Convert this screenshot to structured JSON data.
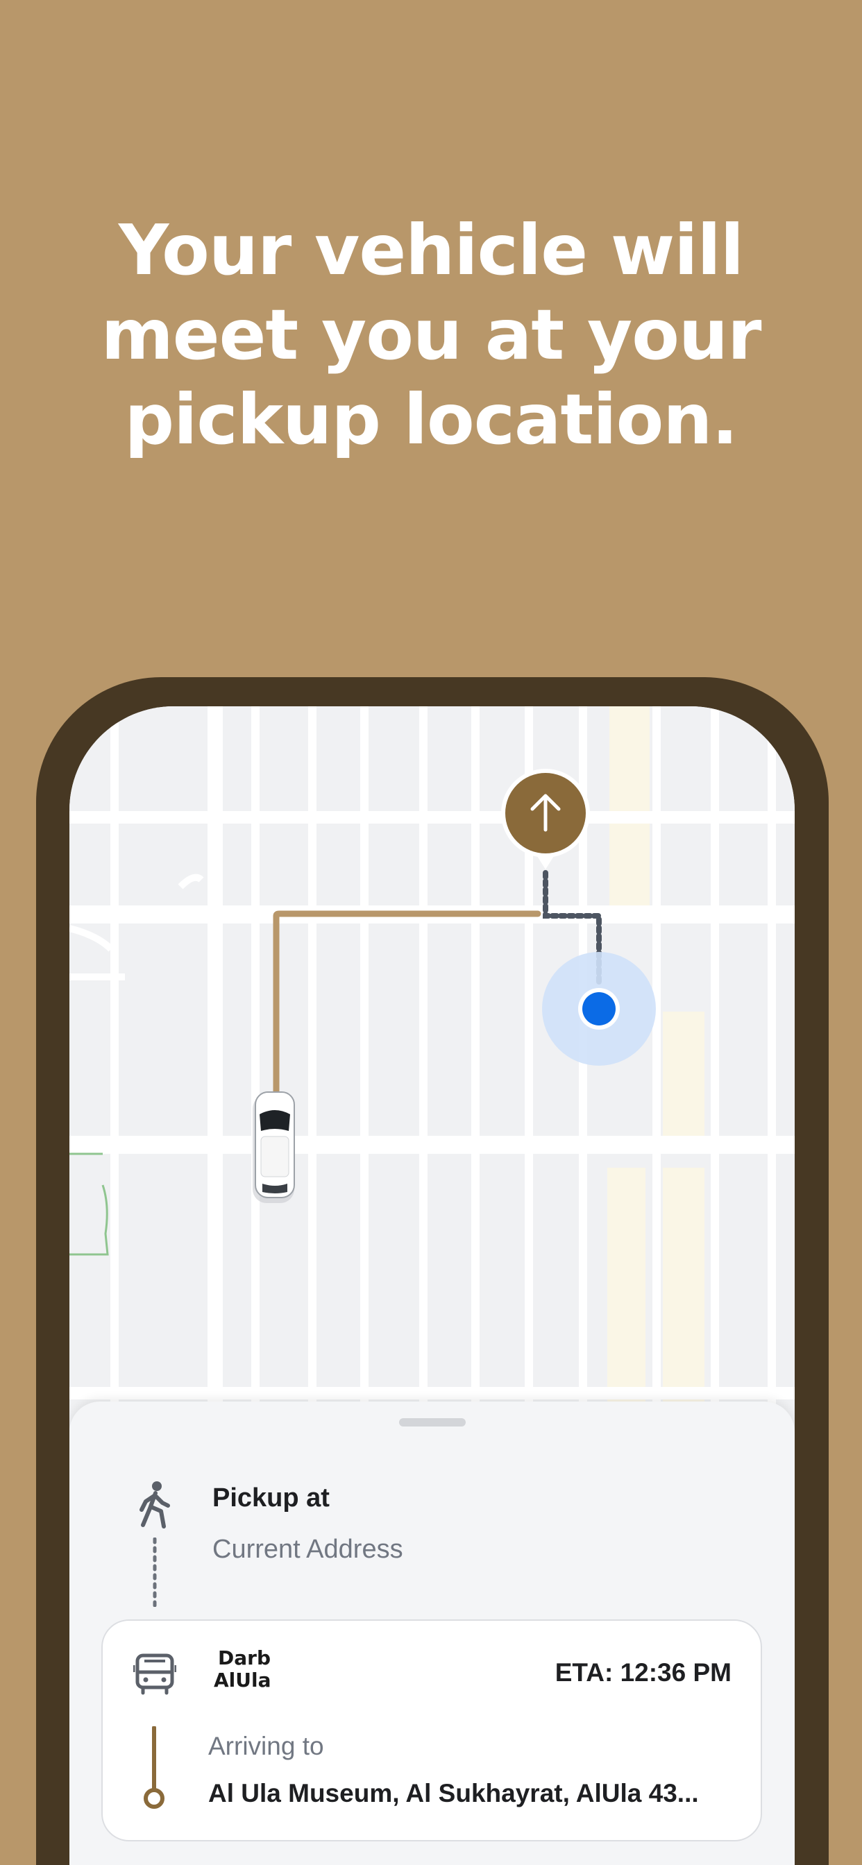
{
  "headline": {
    "line1": "Your vehicle will",
    "line2": "meet you at your",
    "line3": "pickup location."
  },
  "colors": {
    "background": "#b8976a",
    "phone_frame": "#473823",
    "route": "#b8976a",
    "destination_pin": "#8a6a3a",
    "user_location": "#0b6be6"
  },
  "map": {
    "icons": {
      "destination": "arrow-up-icon",
      "user": "user-location-dot",
      "vehicle": "car-icon"
    }
  },
  "sheet": {
    "pickup": {
      "icon": "walking-person-icon",
      "title": "Pickup at",
      "address": "Current Address"
    },
    "trip": {
      "vehicle_icon": "bus-icon",
      "brand_line1": "Darb",
      "brand_line2": "AlUla",
      "eta": "ETA: 12:36 PM",
      "arriving_label": "Arriving to",
      "destination": "Al Ula Museum, Al Sukhayrat, AlUla 43..."
    }
  }
}
